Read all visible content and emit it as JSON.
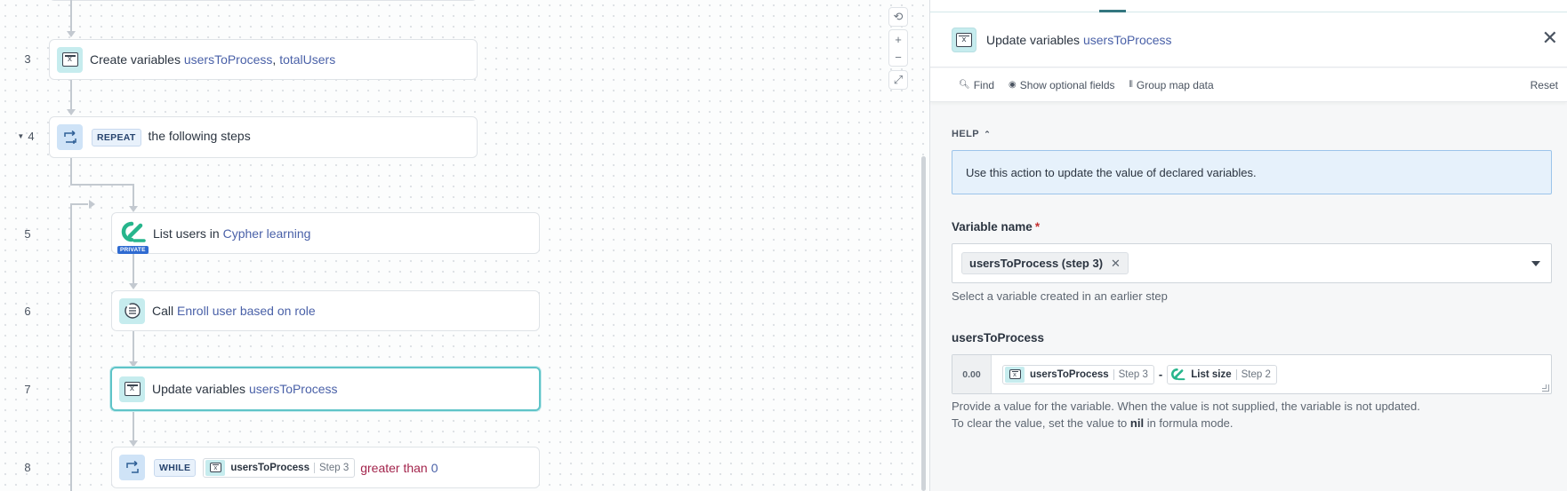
{
  "canvas": {
    "steps": [
      {
        "num": "3",
        "prefix": "Create variables",
        "vars": [
          "usersToProcess",
          "totalUsers"
        ],
        "sep": ", "
      },
      {
        "num": "4",
        "keyword": "REPEAT",
        "text": "the following steps"
      },
      {
        "num": "5",
        "prefix": "List users in",
        "app": "Cypher learning",
        "badge": "PRIVATE"
      },
      {
        "num": "6",
        "prefix": "Call",
        "target": "Enroll user based on role"
      },
      {
        "num": "7",
        "prefix": "Update variables",
        "var": "usersToProcess"
      },
      {
        "num": "8",
        "keyword": "WHILE",
        "pill_name": "usersToProcess",
        "pill_step": "Step 3",
        "op": "greater than",
        "value": "0"
      }
    ],
    "zoom": {
      "reset": "⟲",
      "in": "+",
      "out": "−",
      "fit": "⤢"
    }
  },
  "panel": {
    "title_prefix": "Update variables",
    "title_var": "usersToProcess",
    "close": "✕",
    "toolbar": {
      "find": "Find",
      "optional": "Show optional fields",
      "group": "Group map data",
      "reset": "Reset"
    },
    "help": {
      "label": "HELP",
      "text": "Use this action to update the value of declared variables."
    },
    "variable_name": {
      "label": "Variable name",
      "required": "*",
      "chip": "usersToProcess (step 3)",
      "chip_remove": "✕",
      "hint": "Select a variable created in an earlier step"
    },
    "value_field": {
      "label": "usersToProcess",
      "type": "0.00",
      "pill1_name": "usersToProcess",
      "pill1_step": "Step 3",
      "operator": "-",
      "pill2_name": "List size",
      "pill2_step": "Step 2",
      "hint_line1": "Provide a value for the variable. When the value is not supplied, the variable is not updated.",
      "hint_line2_pre": "To clear the value, set the value to ",
      "hint_line2_bold": "nil",
      "hint_line2_post": " in formula mode."
    }
  },
  "colors": {
    "accent": "#5fc4c8",
    "variable_link": "#4a61a8",
    "help_bg": "#e6f1fb",
    "keyword_bg": "#e8f1fb",
    "operator_red": "#a3244c",
    "private_badge": "#2f6bd1",
    "logo_green": "#27b58c"
  },
  "icons": {
    "variables": "variables-icon",
    "repeat": "repeat-loop-icon",
    "cypher": "cypher-learning-logo",
    "call": "call-function-icon",
    "while": "while-loop-icon",
    "find": "search-icon",
    "optional": "eye-icon",
    "group": "group-icon",
    "close": "close-icon",
    "dropdown": "chevron-down-icon"
  }
}
